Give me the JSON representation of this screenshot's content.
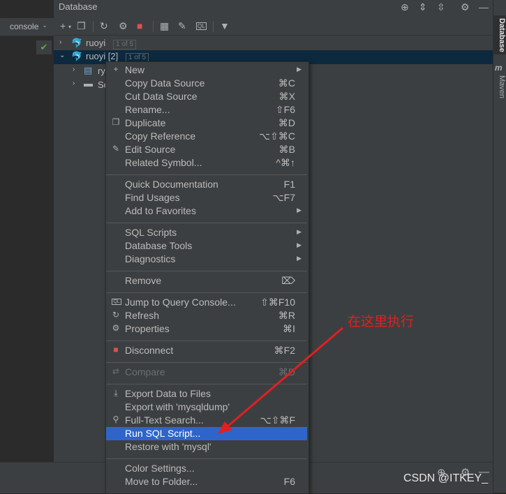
{
  "left": {
    "console_label": "console",
    "check_icon": "✔"
  },
  "panel": {
    "title": "Database"
  },
  "tree": {
    "row1": {
      "name": "ruoyi",
      "badge": "1 of 5"
    },
    "row2": {
      "name": "ruoyi [2]",
      "badge": "1 of 5"
    },
    "row3": {
      "name": "ry"
    },
    "row4": {
      "name": "Se"
    }
  },
  "stripe": {
    "database": "Database",
    "maven": "Maven",
    "maven_icon": "m"
  },
  "menu": {
    "items": [
      {
        "label": "New",
        "shortcut": "",
        "icon": "+",
        "submenu": "▶"
      },
      {
        "label": "Copy Data Source",
        "shortcut": "⌘C",
        "icon": "",
        "submenu": ""
      },
      {
        "label": "Cut Data Source",
        "shortcut": "⌘X",
        "icon": "",
        "submenu": ""
      },
      {
        "label": "Rename...",
        "shortcut": "⇧F6",
        "icon": "",
        "submenu": ""
      },
      {
        "label": "Duplicate",
        "shortcut": "⌘D",
        "icon": "❐",
        "submenu": ""
      },
      {
        "label": "Copy Reference",
        "shortcut": "⌥⇧⌘C",
        "icon": "",
        "submenu": ""
      },
      {
        "label": "Edit Source",
        "shortcut": "⌘B",
        "icon": "✎",
        "submenu": ""
      },
      {
        "label": "Related Symbol...",
        "shortcut": "^⌘↑",
        "icon": "",
        "submenu": ""
      },
      {
        "label": "Quick Documentation",
        "shortcut": "F1",
        "icon": "",
        "submenu": ""
      },
      {
        "label": "Find Usages",
        "shortcut": "⌥F7",
        "icon": "",
        "submenu": ""
      },
      {
        "label": "Add to Favorites",
        "shortcut": "",
        "icon": "",
        "submenu": "▶"
      },
      {
        "label": "SQL Scripts",
        "shortcut": "",
        "icon": "",
        "submenu": "▶"
      },
      {
        "label": "Database Tools",
        "shortcut": "",
        "icon": "",
        "submenu": "▶"
      },
      {
        "label": "Diagnostics",
        "shortcut": "",
        "icon": "",
        "submenu": "▶"
      },
      {
        "label": "Remove",
        "shortcut": "⌦",
        "icon": "",
        "submenu": ""
      },
      {
        "label": "Jump to Query Console...",
        "shortcut": "⇧⌘F10",
        "icon": "QL",
        "submenu": ""
      },
      {
        "label": "Refresh",
        "shortcut": "⌘R",
        "icon": "↻",
        "submenu": ""
      },
      {
        "label": "Properties",
        "shortcut": "⌘I",
        "icon": "⚙",
        "submenu": ""
      },
      {
        "label": "Disconnect",
        "shortcut": "⌘F2",
        "icon": "■",
        "submenu": ""
      },
      {
        "label": "Compare",
        "shortcut": "⌘D",
        "icon": "⇄",
        "submenu": ""
      },
      {
        "label": "Export Data to Files",
        "shortcut": "",
        "icon": "⤓",
        "submenu": ""
      },
      {
        "label": "Export with 'mysqldump'",
        "shortcut": "",
        "icon": "",
        "submenu": ""
      },
      {
        "label": "Full-Text Search...",
        "shortcut": "⌥⇧⌘F",
        "icon": "⚲",
        "submenu": ""
      },
      {
        "label": "Run SQL Script...",
        "shortcut": "",
        "icon": "",
        "submenu": ""
      },
      {
        "label": "Restore with 'mysql'",
        "shortcut": "",
        "icon": "",
        "submenu": ""
      },
      {
        "label": "Color Settings...",
        "shortcut": "",
        "icon": "",
        "submenu": ""
      },
      {
        "label": "Move to Folder...",
        "shortcut": "F6",
        "icon": "",
        "submenu": ""
      }
    ],
    "selected_index": 23,
    "disabled_index": 19
  },
  "annotation": {
    "text": "在这里执行",
    "color": "#e02020"
  },
  "watermark": "CSDN @ITKEY_",
  "colors": {
    "selection": "#2f65ca",
    "disconnect": "#d9534f",
    "mysql_icon": "#4fa3d1"
  }
}
